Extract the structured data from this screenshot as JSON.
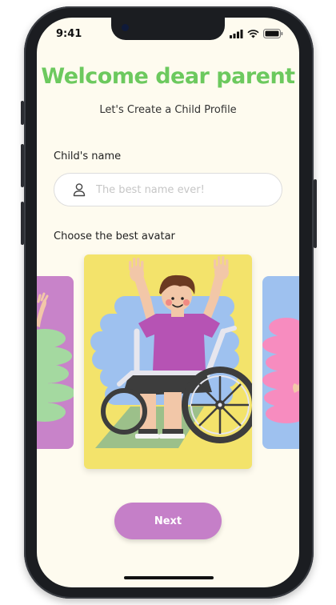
{
  "status_bar": {
    "time": "9:41",
    "icons": [
      "signal-icon",
      "wifi-icon",
      "battery-icon"
    ]
  },
  "header": {
    "title": "Welcome dear parent",
    "subtitle": "Let's Create a Child Profile"
  },
  "form": {
    "name_label": "Child's name",
    "name_value": "",
    "name_placeholder": "The best name ever!",
    "avatar_label": "Choose the best avatar"
  },
  "avatars": [
    {
      "position": "left",
      "bg_color": "#c883c9",
      "selected": false
    },
    {
      "position": "center",
      "bg_color": "#f3e36b",
      "selected": true
    },
    {
      "position": "right",
      "bg_color": "#9ec1ef",
      "selected": false
    }
  ],
  "actions": {
    "next_label": "Next"
  },
  "colors": {
    "title": "#6cc95e",
    "button": "#c57fc8",
    "screen_bg": "#fefbef"
  }
}
